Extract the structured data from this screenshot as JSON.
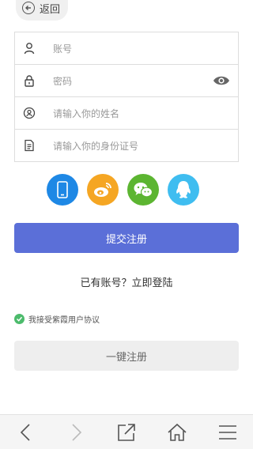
{
  "header": {
    "back_label": "返回"
  },
  "form": {
    "account_placeholder": "账号",
    "password_placeholder": "密码",
    "name_placeholder": "请输入你的姓名",
    "id_placeholder": "请输入你的身份证号"
  },
  "social": [
    {
      "icon": "phone-icon",
      "color": "#1e88e5"
    },
    {
      "icon": "weibo-icon",
      "color": "#f5a623"
    },
    {
      "icon": "wechat-icon",
      "color": "#5cb531"
    },
    {
      "icon": "qq-icon",
      "color": "#3fbdf0"
    }
  ],
  "submit_label": "提交注册",
  "login": {
    "prompt": "已有账号？",
    "link": "立即登陆"
  },
  "agreement": {
    "text": "我接受紫霞用户协议"
  },
  "quick_register_label": "一键注册",
  "colors": {
    "primary": "#5b6fd8",
    "check": "#4cbb6c"
  },
  "bottom_nav": [
    "back-icon",
    "forward-icon",
    "share-icon",
    "home-icon",
    "menu-icon"
  ]
}
